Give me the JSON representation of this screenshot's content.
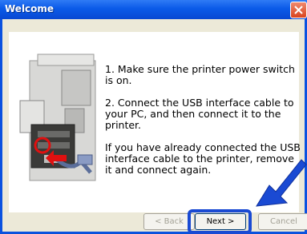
{
  "window": {
    "title": "Welcome"
  },
  "instructions": {
    "step1": "1. Make sure the printer power switch is on.",
    "step2": "2. Connect the USB interface cable to your PC, and then connect it to the printer.",
    "note": "If you have already connected the USB interface cable to the printer, remove it and connect again."
  },
  "buttons": {
    "back": "< Back",
    "next": "Next >",
    "cancel": "Cancel"
  },
  "colors": {
    "titlebar": "#0a5ae8",
    "highlight": "#1a4ad3",
    "client": "#ece9d8"
  },
  "icons": [
    "close-icon",
    "printer-illustration",
    "pointer-arrow"
  ]
}
